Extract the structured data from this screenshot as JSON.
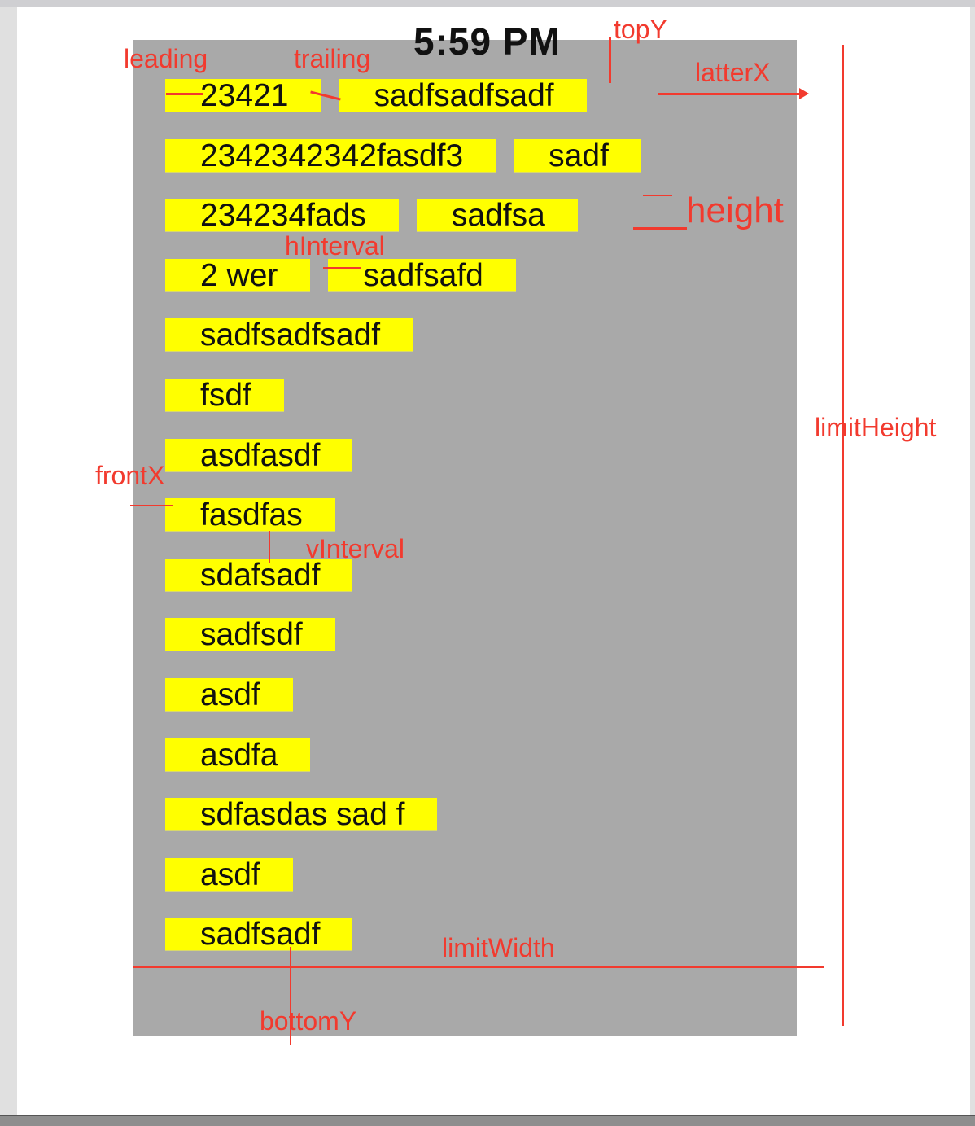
{
  "clock": "5:59 PM",
  "rows": [
    [
      "23421",
      "sadfsadfsadf"
    ],
    [
      "2342342342fasdf3",
      "sadf"
    ],
    [
      "234234fads",
      "sadfsa"
    ],
    [
      "2 wer",
      "sadfsafd"
    ],
    [
      "sadfsadfsadf"
    ],
    [
      "fsdf"
    ],
    [
      "asdfasdf"
    ],
    [
      "fasdfas"
    ],
    [
      "sdafsadf"
    ],
    [
      "sadfsdf"
    ],
    [
      "asdf"
    ],
    [
      "asdfa"
    ],
    [
      "sdfasdas sad f"
    ],
    [
      "asdf"
    ],
    [
      "sadfsadf"
    ]
  ],
  "annotations": {
    "leading": "leading",
    "trailing": "trailing",
    "topY": "topY",
    "latterX": "latterX",
    "height": "height",
    "hInterval": "hInterval",
    "limitHeight": "limitHeight",
    "frontX": "frontX",
    "vInterval": "vInterval",
    "limitWidth": "limitWidth",
    "bottomY": "bottomY"
  },
  "colors": {
    "panel": "#a9a9a9",
    "tag": "#ffff00",
    "annotation": "#f23a2e"
  }
}
